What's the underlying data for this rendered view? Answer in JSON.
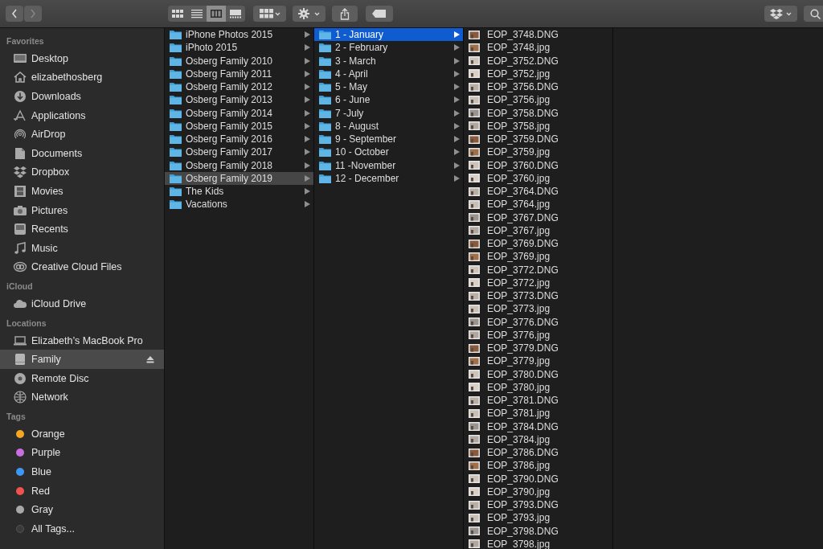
{
  "toolbar": {
    "back": {
      "disabled": false
    },
    "forward": {
      "disabled": true
    },
    "views": [
      {
        "selected": false
      },
      {
        "selected": false
      },
      {
        "selected": true
      },
      {
        "selected": false
      }
    ]
  },
  "sidebar": {
    "sections": [
      {
        "title": "Favorites",
        "items": [
          {
            "label": "Desktop",
            "selected": false
          },
          {
            "label": "elizabethosberg",
            "selected": false
          },
          {
            "label": "Downloads",
            "selected": false
          },
          {
            "label": "Applications",
            "selected": false
          },
          {
            "label": "AirDrop",
            "selected": false
          },
          {
            "label": "Documents",
            "selected": false
          },
          {
            "label": "Dropbox",
            "selected": false
          },
          {
            "label": "Movies",
            "selected": false
          },
          {
            "label": "Pictures",
            "selected": false
          },
          {
            "label": "Recents",
            "selected": false
          },
          {
            "label": "Music",
            "selected": false
          },
          {
            "label": "Creative Cloud Files",
            "selected": false
          }
        ]
      },
      {
        "title": "iCloud",
        "items": [
          {
            "label": "iCloud Drive",
            "selected": false
          }
        ]
      },
      {
        "title": "Locations",
        "items": [
          {
            "label": "Elizabeth’s MacBook Pro",
            "selected": false,
            "ejectable": false
          },
          {
            "label": "Family",
            "selected": true,
            "ejectable": true
          },
          {
            "label": "Remote Disc",
            "selected": false,
            "ejectable": false
          },
          {
            "label": "Network",
            "selected": false,
            "ejectable": false
          }
        ]
      }
    ],
    "tags": {
      "title": "Tags",
      "items": [
        {
          "label": "Orange",
          "color": "#f5a623"
        },
        {
          "label": "Purple",
          "color": "#c86ee0"
        },
        {
          "label": "Blue",
          "color": "#3d97f5"
        },
        {
          "label": "Red",
          "color": "#f0524f"
        },
        {
          "label": "Gray",
          "color": "#a8a8ab"
        }
      ],
      "all": "All Tags..."
    }
  },
  "columns": [
    {
      "items": [
        {
          "name": "iPhone Photos 2015",
          "selected": false
        },
        {
          "name": "iPhoto 2015",
          "selected": false
        },
        {
          "name": "Osberg Family 2010",
          "selected": false
        },
        {
          "name": "Osberg Family 2011",
          "selected": false
        },
        {
          "name": "Osberg Family 2012",
          "selected": false
        },
        {
          "name": "Osberg Family 2013",
          "selected": false
        },
        {
          "name": "Osberg Family 2014",
          "selected": false
        },
        {
          "name": "Osberg Family 2015",
          "selected": false
        },
        {
          "name": "Osberg Family 2016",
          "selected": false
        },
        {
          "name": "Osberg Family 2017",
          "selected": false
        },
        {
          "name": "Osberg Family 2018",
          "selected": false
        },
        {
          "name": "Osberg Family 2019",
          "selected": true
        },
        {
          "name": "The Kids",
          "selected": false
        },
        {
          "name": "Vacations",
          "selected": false
        }
      ]
    },
    {
      "items": [
        {
          "name": "1 - January",
          "selected": true
        },
        {
          "name": "2 - February",
          "selected": false
        },
        {
          "name": "3 - March",
          "selected": false
        },
        {
          "name": "4 - April",
          "selected": false
        },
        {
          "name": "5 - May",
          "selected": false
        },
        {
          "name": "6 - June",
          "selected": false
        },
        {
          "name": "7 -July",
          "selected": false
        },
        {
          "name": "8 - August",
          "selected": false
        },
        {
          "name": "9 - September",
          "selected": false
        },
        {
          "name": "10 - October",
          "selected": false
        },
        {
          "name": "11 -November",
          "selected": false
        },
        {
          "name": "12 - December",
          "selected": false
        }
      ]
    }
  ],
  "files": [
    "EOP_3748.DNG",
    "EOP_3748.jpg",
    "EOP_3752.DNG",
    "EOP_3752.jpg",
    "EOP_3756.DNG",
    "EOP_3756.jpg",
    "EOP_3758.DNG",
    "EOP_3758.jpg",
    "EOP_3759.DNG",
    "EOP_3759.jpg",
    "EOP_3760.DNG",
    "EOP_3760.jpg",
    "EOP_3764.DNG",
    "EOP_3764.jpg",
    "EOP_3767.DNG",
    "EOP_3767.jpg",
    "EOP_3769.DNG",
    "EOP_3769.jpg",
    "EOP_3772.DNG",
    "EOP_3772.jpg",
    "EOP_3773.DNG",
    "EOP_3773.jpg",
    "EOP_3776.DNG",
    "EOP_3776.jpg",
    "EOP_3779.DNG",
    "EOP_3779.jpg",
    "EOP_3780.DNG",
    "EOP_3780.jpg",
    "EOP_3781.DNG",
    "EOP_3781.jpg",
    "EOP_3784.DNG",
    "EOP_3784.jpg",
    "EOP_3786.DNG",
    "EOP_3786.jpg",
    "EOP_3790.DNG",
    "EOP_3790.jpg",
    "EOP_3793.DNG",
    "EOP_3793.jpg",
    "EOP_3798.DNG",
    "EOP_3798.jpg"
  ]
}
